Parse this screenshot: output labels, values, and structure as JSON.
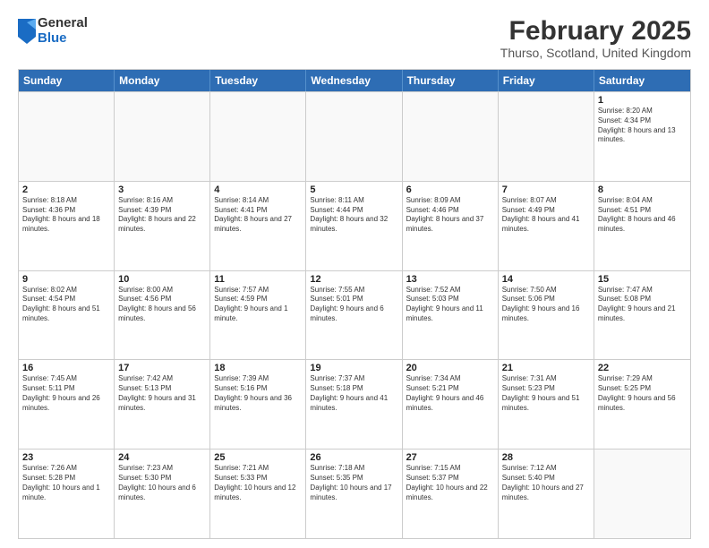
{
  "logo": {
    "general": "General",
    "blue": "Blue"
  },
  "title": "February 2025",
  "subtitle": "Thurso, Scotland, United Kingdom",
  "headers": [
    "Sunday",
    "Monday",
    "Tuesday",
    "Wednesday",
    "Thursday",
    "Friday",
    "Saturday"
  ],
  "weeks": [
    [
      {
        "day": "",
        "text": ""
      },
      {
        "day": "",
        "text": ""
      },
      {
        "day": "",
        "text": ""
      },
      {
        "day": "",
        "text": ""
      },
      {
        "day": "",
        "text": ""
      },
      {
        "day": "",
        "text": ""
      },
      {
        "day": "1",
        "text": "Sunrise: 8:20 AM\nSunset: 4:34 PM\nDaylight: 8 hours and 13 minutes."
      }
    ],
    [
      {
        "day": "2",
        "text": "Sunrise: 8:18 AM\nSunset: 4:36 PM\nDaylight: 8 hours and 18 minutes."
      },
      {
        "day": "3",
        "text": "Sunrise: 8:16 AM\nSunset: 4:39 PM\nDaylight: 8 hours and 22 minutes."
      },
      {
        "day": "4",
        "text": "Sunrise: 8:14 AM\nSunset: 4:41 PM\nDaylight: 8 hours and 27 minutes."
      },
      {
        "day": "5",
        "text": "Sunrise: 8:11 AM\nSunset: 4:44 PM\nDaylight: 8 hours and 32 minutes."
      },
      {
        "day": "6",
        "text": "Sunrise: 8:09 AM\nSunset: 4:46 PM\nDaylight: 8 hours and 37 minutes."
      },
      {
        "day": "7",
        "text": "Sunrise: 8:07 AM\nSunset: 4:49 PM\nDaylight: 8 hours and 41 minutes."
      },
      {
        "day": "8",
        "text": "Sunrise: 8:04 AM\nSunset: 4:51 PM\nDaylight: 8 hours and 46 minutes."
      }
    ],
    [
      {
        "day": "9",
        "text": "Sunrise: 8:02 AM\nSunset: 4:54 PM\nDaylight: 8 hours and 51 minutes."
      },
      {
        "day": "10",
        "text": "Sunrise: 8:00 AM\nSunset: 4:56 PM\nDaylight: 8 hours and 56 minutes."
      },
      {
        "day": "11",
        "text": "Sunrise: 7:57 AM\nSunset: 4:59 PM\nDaylight: 9 hours and 1 minute."
      },
      {
        "day": "12",
        "text": "Sunrise: 7:55 AM\nSunset: 5:01 PM\nDaylight: 9 hours and 6 minutes."
      },
      {
        "day": "13",
        "text": "Sunrise: 7:52 AM\nSunset: 5:03 PM\nDaylight: 9 hours and 11 minutes."
      },
      {
        "day": "14",
        "text": "Sunrise: 7:50 AM\nSunset: 5:06 PM\nDaylight: 9 hours and 16 minutes."
      },
      {
        "day": "15",
        "text": "Sunrise: 7:47 AM\nSunset: 5:08 PM\nDaylight: 9 hours and 21 minutes."
      }
    ],
    [
      {
        "day": "16",
        "text": "Sunrise: 7:45 AM\nSunset: 5:11 PM\nDaylight: 9 hours and 26 minutes."
      },
      {
        "day": "17",
        "text": "Sunrise: 7:42 AM\nSunset: 5:13 PM\nDaylight: 9 hours and 31 minutes."
      },
      {
        "day": "18",
        "text": "Sunrise: 7:39 AM\nSunset: 5:16 PM\nDaylight: 9 hours and 36 minutes."
      },
      {
        "day": "19",
        "text": "Sunrise: 7:37 AM\nSunset: 5:18 PM\nDaylight: 9 hours and 41 minutes."
      },
      {
        "day": "20",
        "text": "Sunrise: 7:34 AM\nSunset: 5:21 PM\nDaylight: 9 hours and 46 minutes."
      },
      {
        "day": "21",
        "text": "Sunrise: 7:31 AM\nSunset: 5:23 PM\nDaylight: 9 hours and 51 minutes."
      },
      {
        "day": "22",
        "text": "Sunrise: 7:29 AM\nSunset: 5:25 PM\nDaylight: 9 hours and 56 minutes."
      }
    ],
    [
      {
        "day": "23",
        "text": "Sunrise: 7:26 AM\nSunset: 5:28 PM\nDaylight: 10 hours and 1 minute."
      },
      {
        "day": "24",
        "text": "Sunrise: 7:23 AM\nSunset: 5:30 PM\nDaylight: 10 hours and 6 minutes."
      },
      {
        "day": "25",
        "text": "Sunrise: 7:21 AM\nSunset: 5:33 PM\nDaylight: 10 hours and 12 minutes."
      },
      {
        "day": "26",
        "text": "Sunrise: 7:18 AM\nSunset: 5:35 PM\nDaylight: 10 hours and 17 minutes."
      },
      {
        "day": "27",
        "text": "Sunrise: 7:15 AM\nSunset: 5:37 PM\nDaylight: 10 hours and 22 minutes."
      },
      {
        "day": "28",
        "text": "Sunrise: 7:12 AM\nSunset: 5:40 PM\nDaylight: 10 hours and 27 minutes."
      },
      {
        "day": "",
        "text": ""
      }
    ]
  ]
}
